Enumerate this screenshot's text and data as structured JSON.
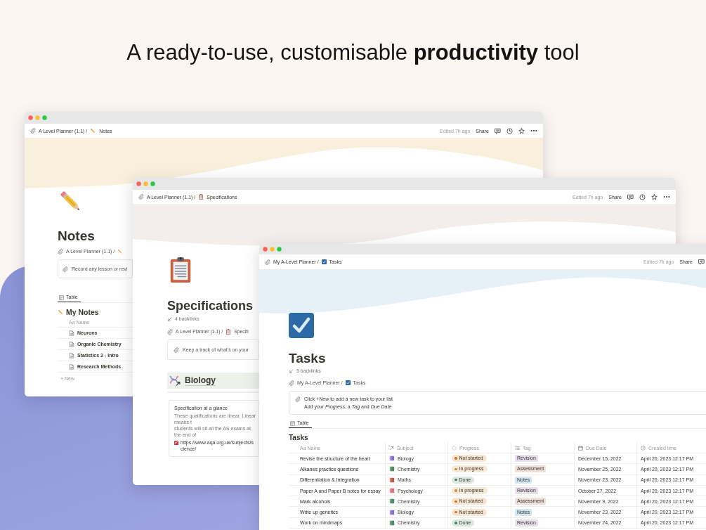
{
  "headline": "A ready-to-use, customisable **productivity** tool",
  "notes_window": {
    "breadcrumb": [
      "A Level Planner (1.1) /",
      "Notes"
    ],
    "edited": "Edited 7h ago",
    "share": "Share",
    "title": "Notes",
    "page_breadcrumb": "A Level Planner (1.1) /",
    "callout": "Record any lesson or revi",
    "view_tab": "Table",
    "database_title": "My Notes",
    "name_column": "Aa Name",
    "rows": [
      "Neurons",
      "Organic Chemistry",
      "Statistics 2 - Intro",
      "Research Methods"
    ],
    "new_row": "+ New"
  },
  "specs_window": {
    "breadcrumb": [
      "A Level Planner (1.1) /",
      "Specifications"
    ],
    "edited": "Edited 7h ago",
    "share": "Share",
    "title": "Specifications",
    "backlinks": "4 backlinks",
    "page_breadcrumb": [
      "A Level Planner (1.1) /",
      "Specifi"
    ],
    "callout": "Keep a track of what's on your",
    "section": "Biology",
    "bookmark": {
      "title": "Specification at a glance",
      "description": [
        "These qualifications are linear. Linear means t",
        "students will sit all the AS exams at the end of"
      ],
      "url": "https://www.aqa.org.uk/subjects/science/"
    }
  },
  "tasks_window": {
    "breadcrumb": [
      "My A-Level Planner /",
      "Tasks"
    ],
    "edited": "Edited 7h ago",
    "share": "Share",
    "title": "Tasks",
    "backlinks": "5 backlinks",
    "page_breadcrumb": [
      "My A-Level Planner /",
      "Tasks"
    ],
    "callout": [
      "Click +*New* to add a new task to your list",
      "Add your *Progress*, a *Tag* and *Due Date*"
    ],
    "view_tab": "Table",
    "database_title": "Tasks",
    "columns": [
      {
        "label": "Aa Name",
        "kind": "title"
      },
      {
        "label": "Subject",
        "kind": "relation"
      },
      {
        "label": "Progress",
        "kind": "status"
      },
      {
        "label": "Tag",
        "kind": "multi_select"
      },
      {
        "label": "Due Date",
        "kind": "date"
      },
      {
        "label": "Created time",
        "kind": "created_time"
      }
    ],
    "rows": [
      {
        "name": "Revise the structure of the heart",
        "subject": {
          "label": "Biology",
          "color": "#8a6fd1"
        },
        "progress": {
          "label": "Not started",
          "color": "#d9730d"
        },
        "tag": {
          "label": "Revision",
          "color": "#e8deee"
        },
        "due": "December 15, 2022",
        "created": "April 20, 2023 12:17 PM"
      },
      {
        "name": "Alkanes practice questions",
        "subject": {
          "label": "Chemistry",
          "color": "#4d8a5e"
        },
        "progress": {
          "label": "In progress",
          "color": "#cb912f"
        },
        "tag": {
          "label": "Assessment",
          "color": "#eee0da"
        },
        "due": "November 25, 2022",
        "created": "April 20, 2023 12:17 PM"
      },
      {
        "name": "Differentiation & Integration",
        "subject": {
          "label": "Maths",
          "color": "#c4554d"
        },
        "progress": {
          "label": "Done",
          "color": "#448361"
        },
        "tag": {
          "label": "Notes",
          "color": "#d3e5ef"
        },
        "due": "November 23, 2022",
        "created": "April 20, 2023 12:17 PM"
      },
      {
        "name": "Paper A and Paper B notes for essay",
        "subject": {
          "label": "Psychology",
          "color": "#e06c7a"
        },
        "progress": {
          "label": "In progress",
          "color": "#cb912f"
        },
        "tag": {
          "label": "Revision",
          "color": "#e8deee"
        },
        "due": "October 27, 2022",
        "created": "April 20, 2023 12:17 PM"
      },
      {
        "name": "Mark alcohols",
        "subject": {
          "label": "Chemistry",
          "color": "#4d8a5e"
        },
        "progress": {
          "label": "Not started",
          "color": "#d9730d"
        },
        "tag": {
          "label": "Assessment",
          "color": "#eee0da"
        },
        "due": "November 9, 2022",
        "created": "April 20, 2023 12:17 PM"
      },
      {
        "name": "Write up genetics",
        "subject": {
          "label": "Biology",
          "color": "#8a6fd1"
        },
        "progress": {
          "label": "Not started",
          "color": "#d9730d"
        },
        "tag": {
          "label": "Notes",
          "color": "#d3e5ef"
        },
        "due": "November 23, 2022",
        "created": "April 20, 2023 12:17 PM"
      },
      {
        "name": "Work on mindmaps",
        "subject": {
          "label": "Chemistry",
          "color": "#4d8a5e"
        },
        "progress": {
          "label": "Done",
          "color": "#448361"
        },
        "tag": {
          "label": "Revision",
          "color": "#e8deee"
        },
        "due": "November 24, 2022",
        "created": "April 20, 2023 12:17 PM"
      }
    ]
  }
}
